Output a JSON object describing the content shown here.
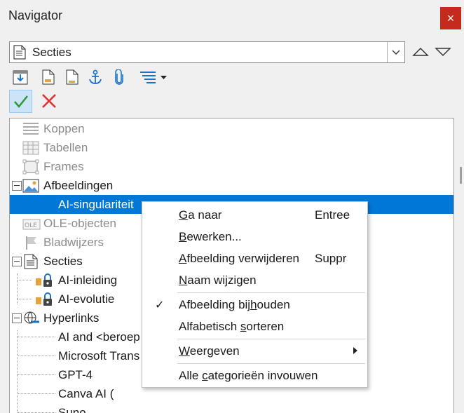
{
  "window": {
    "title": "Navigator",
    "close_label": "×"
  },
  "content_combo": {
    "value": "Secties"
  },
  "tree": {
    "items": [
      {
        "label": "Koppen"
      },
      {
        "label": "Tabellen"
      },
      {
        "label": "Frames"
      },
      {
        "label": "Afbeeldingen"
      },
      {
        "label": "AI-singulariteit"
      },
      {
        "label": "OLE-objecten"
      },
      {
        "label": "Bladwijzers"
      },
      {
        "label": "Secties"
      },
      {
        "label": "AI-inleiding"
      },
      {
        "label": "AI-evolutie"
      },
      {
        "label": "Hyperlinks"
      },
      {
        "label": "AI and <beroep"
      },
      {
        "label": "Microsoft Trans"
      },
      {
        "label": "GPT-4"
      },
      {
        "label": "Canva AI ("
      },
      {
        "label": "Suno"
      }
    ]
  },
  "context_menu": {
    "goto": {
      "pre": "",
      "ul": "G",
      "post": "a naar",
      "shortcut": "Entree"
    },
    "edit": {
      "pre": "",
      "ul": "B",
      "post": "ewerken...",
      "shortcut": ""
    },
    "delete": {
      "pre": "",
      "ul": "A",
      "post": "fbeelding verwijderen",
      "shortcut": "Suppr"
    },
    "rename": {
      "pre": "",
      "ul": "N",
      "post": "aam wijzigen",
      "shortcut": ""
    },
    "track": {
      "pre": "Afbeelding bij",
      "ul": "h",
      "post": "ouden",
      "check": "✓"
    },
    "sort": {
      "pre": "Alfabetisch ",
      "ul": "s",
      "post": "orteren"
    },
    "view": {
      "pre": "",
      "ul": "W",
      "post": "eergeven"
    },
    "collapse": {
      "pre": "Alle ",
      "ul": "c",
      "post": "ategorieën invouwen"
    }
  },
  "colors": {
    "selection": "#0078d7",
    "close": "#c42b1c",
    "ok": "#2a9d3a",
    "cancel": "#e03030"
  }
}
